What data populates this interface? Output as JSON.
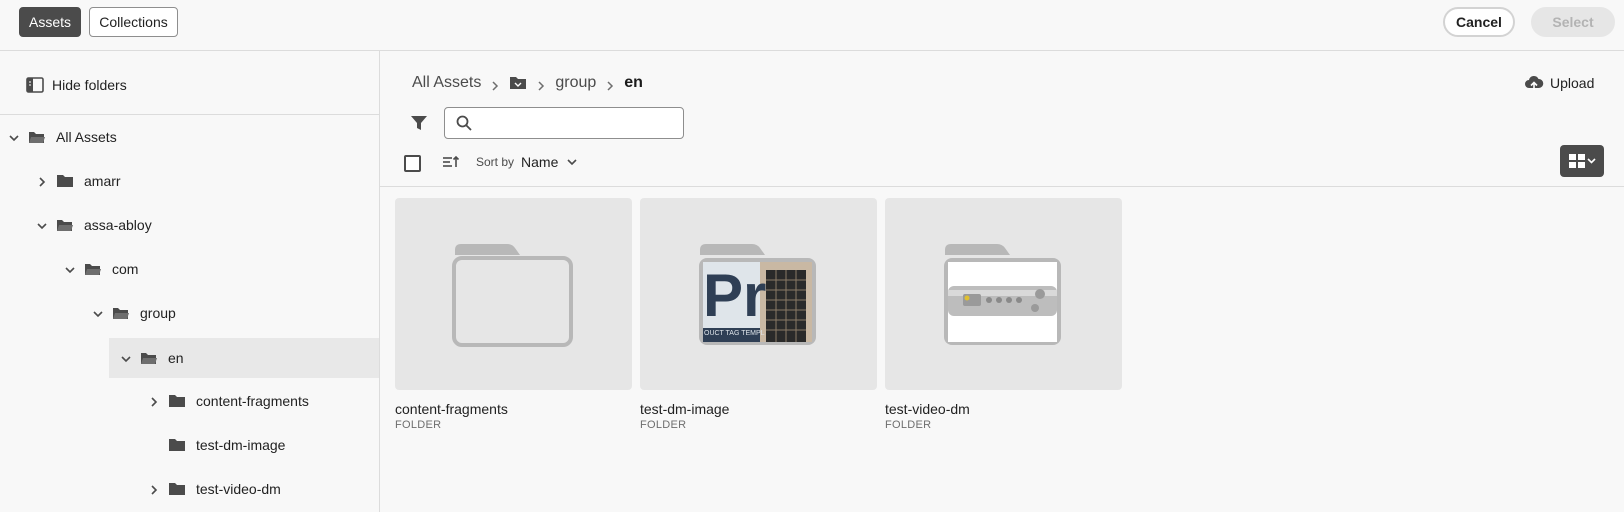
{
  "header": {
    "tabs": [
      {
        "label": "Assets",
        "active": true
      },
      {
        "label": "Collections",
        "active": false
      }
    ],
    "cancel_label": "Cancel",
    "select_label": "Select"
  },
  "sidebar": {
    "hide_folders_label": "Hide folders",
    "tree": [
      {
        "label": "All Assets",
        "expanded": true,
        "has_children": true
      },
      {
        "label": "amarr",
        "expanded": false,
        "has_children": true
      },
      {
        "label": "assa-abloy",
        "expanded": true,
        "has_children": true
      },
      {
        "label": "com",
        "expanded": true,
        "has_children": true
      },
      {
        "label": "group",
        "expanded": true,
        "has_children": true
      },
      {
        "label": "en",
        "expanded": true,
        "has_children": true,
        "selected": true
      },
      {
        "label": "content-fragments",
        "expanded": false,
        "has_children": true
      },
      {
        "label": "test-dm-image",
        "expanded": false,
        "has_children": false
      },
      {
        "label": "test-video-dm",
        "expanded": false,
        "has_children": true
      }
    ]
  },
  "main": {
    "breadcrumb": {
      "root": "All Assets",
      "group": "group",
      "current": "en"
    },
    "upload_label": "Upload",
    "search_placeholder": "",
    "sort_by_label": "Sort by",
    "sort_value": "Name",
    "items": [
      {
        "name": "content-fragments",
        "type": "FOLDER",
        "thumbnail": "empty-folder"
      },
      {
        "name": "test-dm-image",
        "type": "FOLDER",
        "thumbnail": "image-preview",
        "preview_text": "Pr",
        "preview_caption": "OUCT TAG TEMPL"
      },
      {
        "name": "test-video-dm",
        "type": "FOLDER",
        "thumbnail": "video-preview"
      }
    ]
  },
  "colors": {
    "accent_dark": "#4b4b4b",
    "background": "#f8f8f8",
    "thumb_bg": "#e6e6e6"
  }
}
